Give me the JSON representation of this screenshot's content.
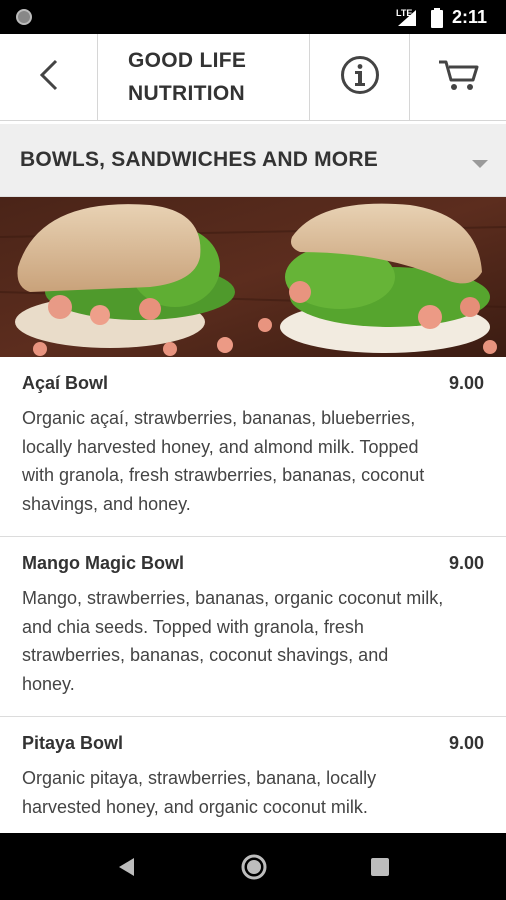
{
  "status_bar": {
    "network": "LTE",
    "time": "2:11"
  },
  "header": {
    "title": "GOOD LIFE\nNUTRITION",
    "back_icon": "chevron-left-icon",
    "info_icon": "info-icon",
    "cart_icon": "cart-icon"
  },
  "category": {
    "label": "BOWLS, SANDWICHES AND MORE",
    "dropdown_icon": "dropdown-arrow-icon"
  },
  "menu": {
    "items": [
      {
        "name": "Açaí Bowl",
        "price": "9.00",
        "description": "Organic açaí, strawberries, bananas, blueberries, locally harvested honey, and almond milk. Topped with granola, fresh strawberries, bananas, coconut shavings, and honey."
      },
      {
        "name": "Mango Magic Bowl",
        "price": "9.00",
        "description": "Mango, strawberries, bananas, organic coconut milk, and chia seeds. Topped with granola, fresh strawberries, bananas, coconut shavings, and honey."
      },
      {
        "name": "Pitaya Bowl",
        "price": "9.00",
        "description": "Organic pitaya, strawberries, banana, locally harvested honey, and organic coconut milk."
      }
    ]
  },
  "colors": {
    "status_bar": "#000000",
    "category_bg": "#efefef",
    "text": "#333333",
    "divider": "#d6d6d6"
  }
}
